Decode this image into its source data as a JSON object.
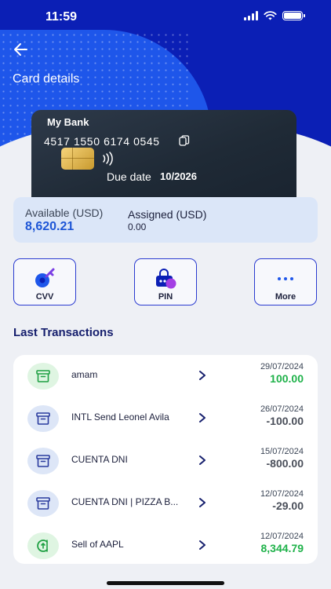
{
  "status_bar": {
    "time": "11:59"
  },
  "header": {
    "title": "Card details",
    "back_icon": "arrow-left-icon"
  },
  "card": {
    "bank_name": "My Bank",
    "number": "4517 1550 6174 0545",
    "due_label": "Due date",
    "due_value": "10/2026"
  },
  "balance": {
    "available_label": "Available (USD)",
    "available_value": "8,620.21",
    "assigned_label": "Assigned (USD)",
    "assigned_value": "0.00"
  },
  "actions": [
    {
      "label": "CVV",
      "icon": "key-icon"
    },
    {
      "label": "PIN",
      "icon": "pin-lock-icon"
    },
    {
      "label": "More",
      "icon": "more-dots-icon"
    }
  ],
  "transactions_title": "Last Transactions",
  "transactions": [
    {
      "name": "amam",
      "date": "29/07/2024",
      "amount": "100.00",
      "kind": "positive",
      "icon": "archive-box-icon",
      "icon_bg": "#dff5e2"
    },
    {
      "name": "INTL Send Leonel Avila",
      "date": "26/07/2024",
      "amount": "-100.00",
      "kind": "negative",
      "icon": "archive-box-icon",
      "icon_bg": "#dde6f7"
    },
    {
      "name": "CUENTA DNI",
      "date": "15/07/2024",
      "amount": "-800.00",
      "kind": "negative",
      "icon": "archive-box-icon",
      "icon_bg": "#dde6f7"
    },
    {
      "name": "CUENTA DNI | PIZZA B...",
      "date": "12/07/2024",
      "amount": "-29.00",
      "kind": "negative",
      "icon": "archive-box-icon",
      "icon_bg": "#dde6f7"
    },
    {
      "name": "Sell of AAPL",
      "date": "12/07/2024",
      "amount": "8,344.79",
      "kind": "positive",
      "icon": "dividend-icon",
      "icon_bg": "#dff5e2"
    }
  ],
  "colors": {
    "primary": "#0b1fb5",
    "accent": "#1e56ea",
    "positive": "#1fb24a",
    "title": "#17206e"
  }
}
